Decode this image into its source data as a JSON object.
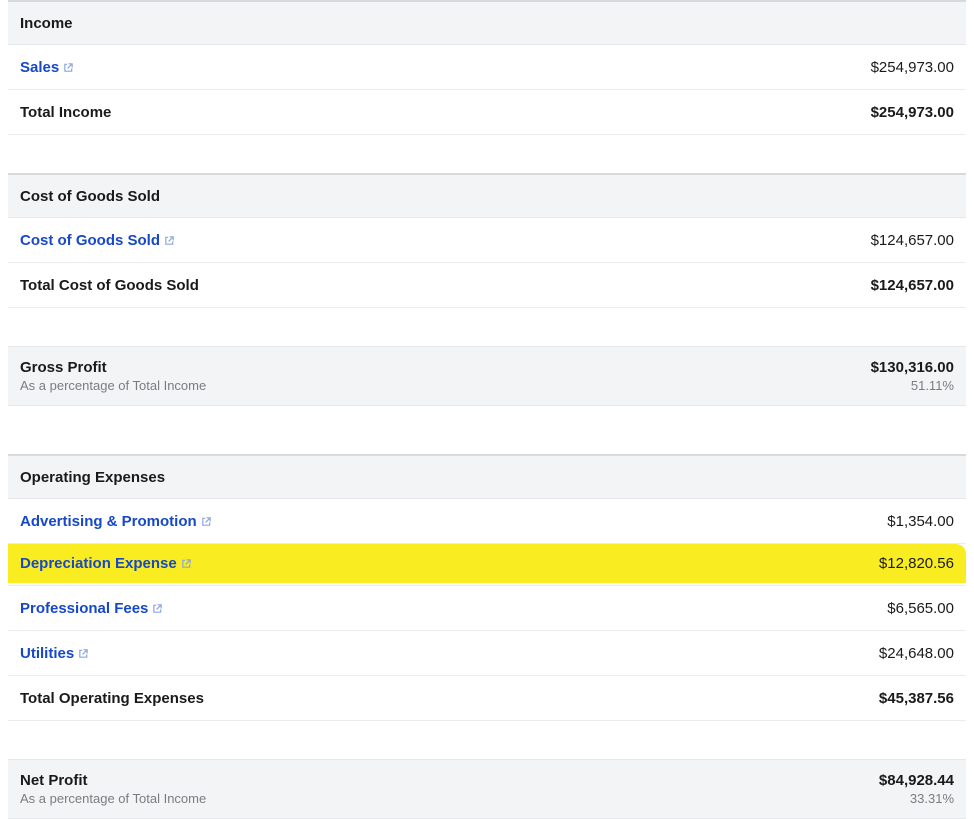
{
  "income": {
    "header": "Income",
    "lines": [
      {
        "label": "Sales",
        "amount": "$254,973.00"
      }
    ],
    "total_label": "Total Income",
    "total_amount": "$254,973.00"
  },
  "cogs": {
    "header": "Cost of Goods Sold",
    "lines": [
      {
        "label": "Cost of Goods Sold",
        "amount": "$124,657.00"
      }
    ],
    "total_label": "Total Cost of Goods Sold",
    "total_amount": "$124,657.00"
  },
  "gross_profit": {
    "title": "Gross Profit",
    "sub": "As a percentage of Total Income",
    "amount": "$130,316.00",
    "pct": "51.11%"
  },
  "opex": {
    "header": "Operating Expenses",
    "lines": [
      {
        "label": "Advertising & Promotion",
        "amount": "$1,354.00",
        "highlight": false
      },
      {
        "label": "Depreciation Expense",
        "amount": "$12,820.56",
        "highlight": true
      },
      {
        "label": "Professional Fees",
        "amount": "$6,565.00",
        "highlight": false
      },
      {
        "label": "Utilities",
        "amount": "$24,648.00",
        "highlight": false
      }
    ],
    "total_label": "Total Operating Expenses",
    "total_amount": "$45,387.56"
  },
  "net_profit": {
    "title": "Net Profit",
    "sub": "As a percentage of Total Income",
    "amount": "$84,928.44",
    "pct": "33.31%"
  }
}
